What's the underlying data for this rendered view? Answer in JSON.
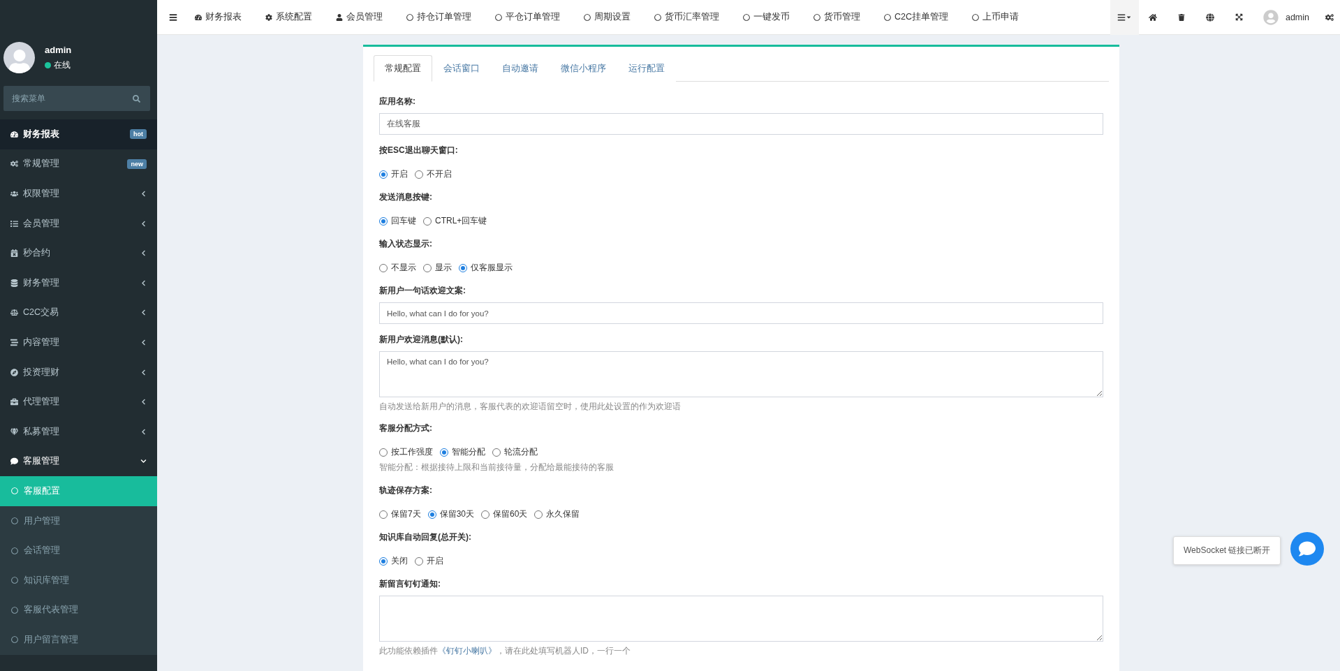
{
  "topbar": {
    "nav": [
      {
        "label": "财务报表",
        "kind": "dashboard"
      },
      {
        "label": "系统配置",
        "kind": "gear"
      },
      {
        "label": "会员管理",
        "kind": "user"
      },
      {
        "label": "持仓订单管理",
        "kind": "circle"
      },
      {
        "label": "平仓订单管理",
        "kind": "circle"
      },
      {
        "label": "周期设置",
        "kind": "circle"
      },
      {
        "label": "货币汇率管理",
        "kind": "circle"
      },
      {
        "label": "一键发币",
        "kind": "circle"
      },
      {
        "label": "货币管理",
        "kind": "circle"
      },
      {
        "label": "C2C挂单管理",
        "kind": "circle"
      },
      {
        "label": "上币申请",
        "kind": "circle"
      }
    ],
    "user": "admin"
  },
  "sidebar": {
    "user": {
      "name": "admin",
      "status": "在线"
    },
    "search": {
      "placeholder": "搜索菜单"
    },
    "items": [
      {
        "label": "财务报表",
        "kind": "dashboard",
        "badge": "hot",
        "selected": true,
        "expanded": false
      },
      {
        "label": "常规管理",
        "kind": "cogs",
        "badge": "new",
        "selected": false,
        "expanded": false
      },
      {
        "label": "权限管理",
        "kind": "users",
        "selected": false,
        "expanded": false
      },
      {
        "label": "会员管理",
        "kind": "list",
        "selected": false,
        "expanded": false
      },
      {
        "label": "秒合约",
        "kind": "calendar",
        "selected": false,
        "expanded": false
      },
      {
        "label": "财务管理",
        "kind": "database",
        "selected": false,
        "expanded": false
      },
      {
        "label": "C2C交易",
        "kind": "balance",
        "selected": false,
        "expanded": false
      },
      {
        "label": "内容管理",
        "kind": "lines",
        "selected": false,
        "expanded": false
      },
      {
        "label": "投资理财",
        "kind": "compass",
        "selected": false,
        "expanded": false
      },
      {
        "label": "代理管理",
        "kind": "briefcase",
        "selected": false,
        "expanded": false
      },
      {
        "label": "私募管理",
        "kind": "gem",
        "selected": false,
        "expanded": false
      },
      {
        "label": "客服管理",
        "kind": "comment",
        "selected": false,
        "expanded": true,
        "children": [
          {
            "label": "客服配置",
            "selected": true
          },
          {
            "label": "用户管理",
            "selected": false
          },
          {
            "label": "会话管理",
            "selected": false
          },
          {
            "label": "知识库管理",
            "selected": false
          },
          {
            "label": "客服代表管理",
            "selected": false
          },
          {
            "label": "用户留言管理",
            "selected": false
          }
        ]
      }
    ]
  },
  "tabs": [
    {
      "label": "常规配置",
      "selected": true
    },
    {
      "label": "会话窗口",
      "selected": false
    },
    {
      "label": "自动邀请",
      "selected": false
    },
    {
      "label": "微信小程序",
      "selected": false
    },
    {
      "label": "运行配置",
      "selected": false
    }
  ],
  "form": [
    {
      "kind": "text",
      "label": "应用名称:",
      "value": "在线客服"
    },
    {
      "kind": "radio",
      "label": "按ESC退出聊天窗口:",
      "options": [
        {
          "label": "开启",
          "selected": true
        },
        {
          "label": "不开启",
          "selected": false
        }
      ]
    },
    {
      "kind": "radio",
      "label": "发送消息按键:",
      "options": [
        {
          "label": "回车键",
          "selected": true
        },
        {
          "label": "CTRL+回车键",
          "selected": false
        }
      ]
    },
    {
      "kind": "radio",
      "label": "输入状态显示:",
      "options": [
        {
          "label": "不显示",
          "selected": false
        },
        {
          "label": "显示",
          "selected": false
        },
        {
          "label": "仅客服显示",
          "selected": true
        }
      ]
    },
    {
      "kind": "text",
      "label": "新用户一句话欢迎文案:",
      "value": "Hello, what can I do for you?"
    },
    {
      "kind": "textarea",
      "label": "新用户欢迎消息(默认):",
      "value": "Hello, what can I do for you?",
      "help": "自动发送给新用户的消息，客服代表的欢迎语留空时，使用此处设置的作为欢迎语"
    },
    {
      "kind": "radio",
      "label": "客服分配方式:",
      "options": [
        {
          "label": "按工作强度",
          "selected": false
        },
        {
          "label": "智能分配",
          "selected": true
        },
        {
          "label": "轮流分配",
          "selected": false
        }
      ],
      "help": "智能分配：根据接待上限和当前接待量，分配给最能接待的客服"
    },
    {
      "kind": "radio",
      "label": "轨迹保存方案:",
      "options": [
        {
          "label": "保留7天",
          "selected": false
        },
        {
          "label": "保留30天",
          "selected": true
        },
        {
          "label": "保留60天",
          "selected": false
        },
        {
          "label": "永久保留",
          "selected": false
        }
      ]
    },
    {
      "kind": "radio",
      "label": "知识库自动回复(总开关):",
      "options": [
        {
          "label": "关闭",
          "selected": true
        },
        {
          "label": "开启",
          "selected": false
        }
      ]
    },
    {
      "kind": "textarea",
      "label": "新留言钉钉通知:",
      "help_before": "此功能依赖插件",
      "help_link": "《钉钉小喇叭》",
      "help_after": "，请在此处填写机器人ID，一行一个"
    }
  ],
  "toast": {
    "text": "WebSocket 链接已断开"
  }
}
